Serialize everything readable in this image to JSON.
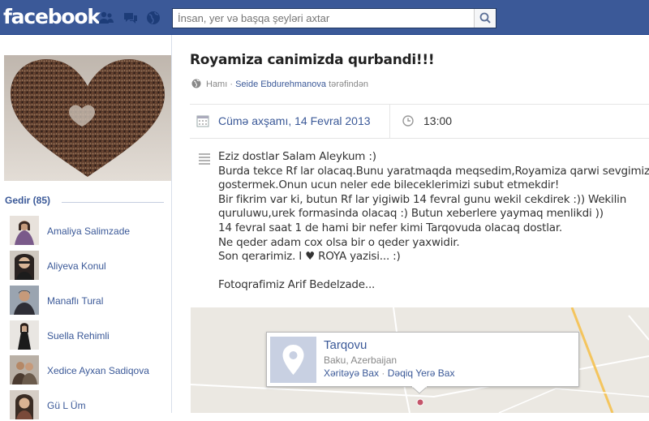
{
  "topbar": {
    "logo": "facebook",
    "search_placeholder": "İnsan, yer və başqa şeyləri axtar"
  },
  "sidebar": {
    "going_label": "Gedir (85)",
    "friends": [
      {
        "name": "Amaliya Salimzade"
      },
      {
        "name": "Aliyeva Konul"
      },
      {
        "name": "Manaflı Tural"
      },
      {
        "name": "Suella Rehimli"
      },
      {
        "name": "Xedice Ayxan Sadiqova"
      },
      {
        "name": "Gü L Üm"
      }
    ]
  },
  "event": {
    "title": "Royamiza canimizda qurbandi!!!",
    "privacy": "Hamı",
    "dot": "·",
    "host": "Seide Ebdurehmanova",
    "by": "tərəfindən",
    "date": "Cümə axşamı, 14 Fevral 2013",
    "time": "13:00",
    "description": [
      "Eziz dostlar Salam Aleykum :)",
      "Burda tekce Rf lar olacaq.Bunu yaratmaqda meqsedim,Royamiza qarwi sevgimizi",
      "gostermek.Onun ucun neler ede bileceklerimizi subut etmekdir!",
      "Bir fikrim var ki, butun Rf lar yigiwib 14 fevral gunu wekil cekdirek :)) Wekilin",
      "quruluwu,urek formasinda olacaq :) Butun xeberlere yaymaq menlikdi ))",
      "14 fevral saat 1 de hami bir nefer kimi Tarqovuda olacaq dostlar.",
      "Ne qeder adam cox olsa bir o qeder yaxwidir.",
      "Son qerarimiz. I ♥ ROYA yazisi... :)",
      "",
      "Fotoqrafimiz Arif Bedelzade..."
    ],
    "location": {
      "name": "Tarqovu",
      "address": "Baku, Azerbaijan",
      "map_link": "Xəritəyə Bax",
      "dot": "·",
      "directions_link": "Dəqiq Yerə Bax"
    }
  },
  "colors": {
    "brand": "#3b5998",
    "link": "#3b5998"
  }
}
